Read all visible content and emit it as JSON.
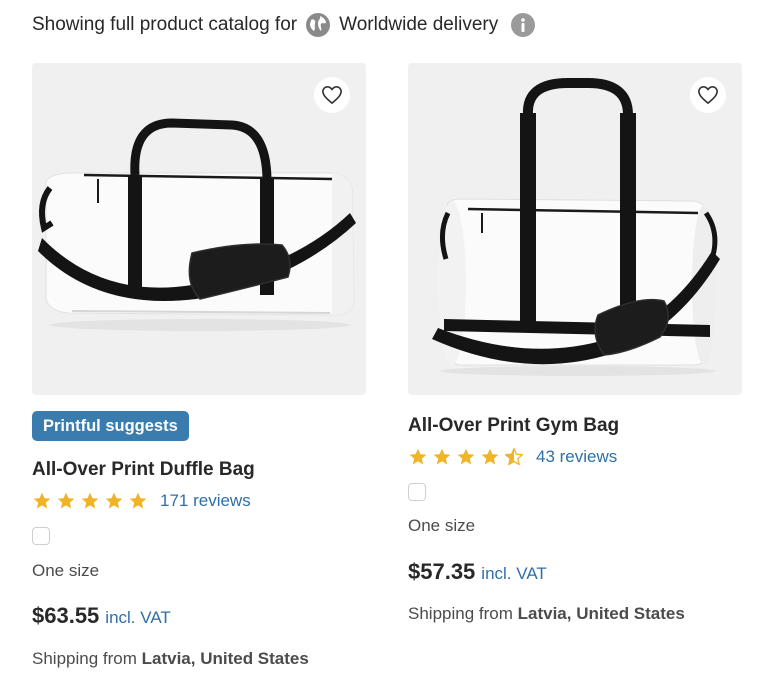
{
  "header": {
    "prefix": "Showing full product catalog for",
    "region": "Worldwide delivery",
    "globe_icon": "globe-icon",
    "info_icon": "info-icon"
  },
  "products": [
    {
      "badge": "Printful suggests",
      "title": "All-Over Print Duffle Bag",
      "rating": 5,
      "reviews": "171 reviews",
      "size": "One size",
      "price": "$63.55",
      "vat": "incl. VAT",
      "ship_prefix": "Shipping from",
      "ship_from": "Latvia, United States"
    },
    {
      "title": "All-Over Print Gym Bag",
      "rating": 4.5,
      "reviews": "43 reviews",
      "size": "One size",
      "price": "$57.35",
      "vat": "incl. VAT",
      "ship_prefix": "Shipping from",
      "ship_from": "Latvia, United States"
    }
  ],
  "colors": {
    "accent_blue": "#3a7cae",
    "link_blue": "#2f6fa8",
    "star_gold": "#f0b429",
    "thumb_bg": "#f0f0f0"
  }
}
